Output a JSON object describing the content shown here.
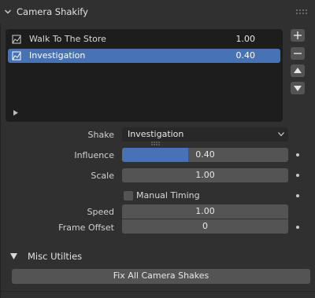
{
  "panel": {
    "title": "Camera Shakify",
    "chevron_icon": "chevron-down-icon",
    "drag_icon": "grip-icon"
  },
  "list": {
    "items": [
      {
        "name": "Walk To The Store",
        "value": "1.00",
        "selected": false,
        "icon": "camera-shake-icon"
      },
      {
        "name": "Investigation",
        "value": "0.40",
        "selected": true,
        "icon": "camera-shake-icon"
      }
    ],
    "side_buttons": [
      "add-icon",
      "remove-icon",
      "move-up-icon",
      "move-down-icon"
    ]
  },
  "properties": {
    "shake": {
      "label": "Shake",
      "value": "Investigation"
    },
    "influence": {
      "label": "Influence",
      "value": "0.40",
      "fraction": 0.4
    },
    "scale": {
      "label": "Scale",
      "value": "1.00"
    },
    "manual_timing": {
      "label": "Manual Timing",
      "checked": false
    },
    "speed": {
      "label": "Speed",
      "value": "1.00"
    },
    "frame_offset": {
      "label": "Frame Offset",
      "value": "0"
    }
  },
  "misc": {
    "title": "Misc Utilties",
    "button": "Fix All Camera Shakes"
  },
  "colors": {
    "accent": "#4772b3",
    "panel_bg": "#303030",
    "list_bg": "#1d1d1d",
    "field_bg": "#545454"
  }
}
